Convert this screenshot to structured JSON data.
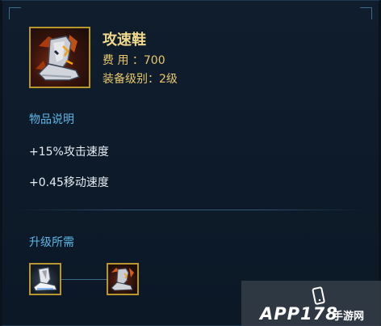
{
  "item": {
    "name": "攻速鞋",
    "cost_line": "费 用 ：700",
    "tier_line": "装备级别：2级",
    "icon": "boots-icon"
  },
  "description": {
    "title": "物品说明",
    "effects": [
      "+15%攻击速度",
      "+0.45移动速度"
    ]
  },
  "upgrade": {
    "title": "升级所需",
    "components": [
      {
        "icon": "basic-boots-icon"
      },
      {
        "icon": "attack-speed-boots-icon"
      }
    ]
  },
  "watermark": {
    "text": "APP178",
    "cn": "手游网"
  },
  "colors": {
    "name": "#f1d98a",
    "stat": "#e8c86a",
    "section": "#5bb7e6",
    "effect": "#e6edf4",
    "frame": "#b8962e"
  }
}
